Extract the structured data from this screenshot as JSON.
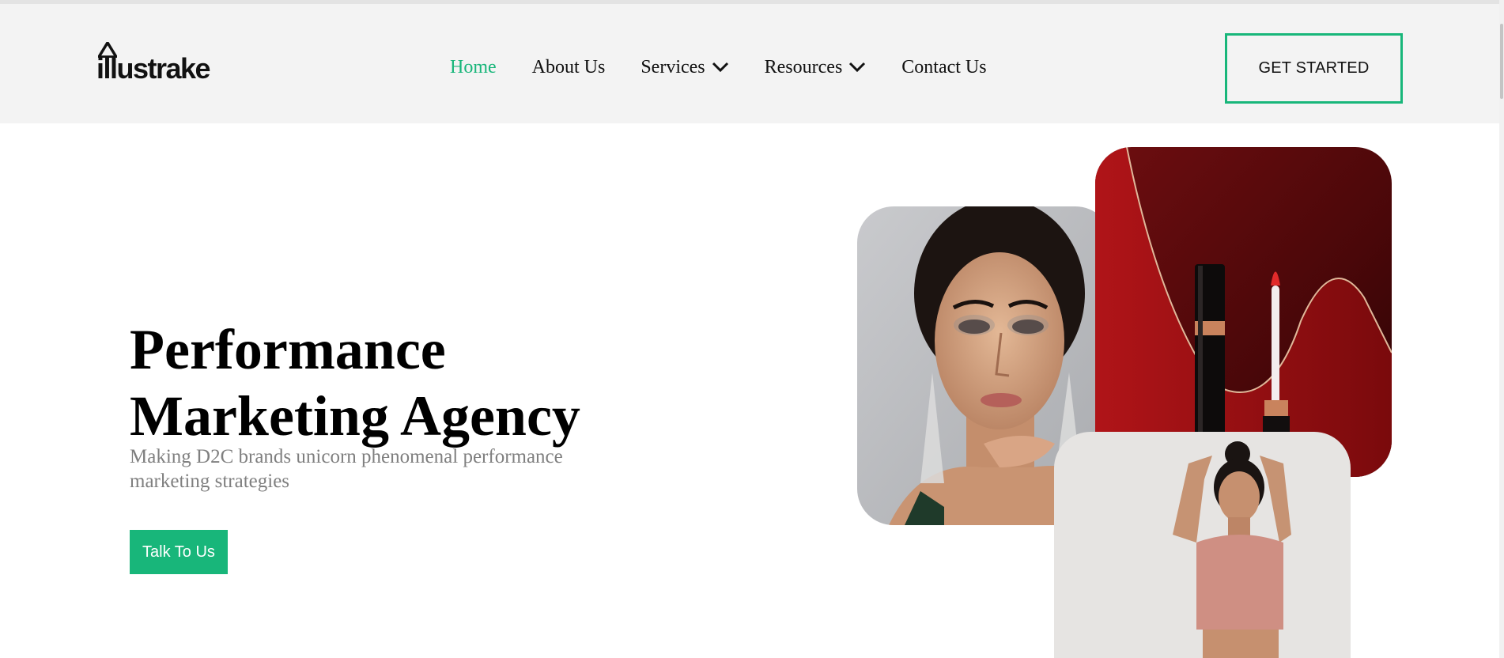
{
  "brand": {
    "name": "illustrake",
    "accent_color": "#18b67a"
  },
  "nav": {
    "items": [
      {
        "label": "Home",
        "active": true,
        "has_dropdown": false
      },
      {
        "label": "About Us",
        "active": false,
        "has_dropdown": false
      },
      {
        "label": "Services",
        "active": false,
        "has_dropdown": true
      },
      {
        "label": "Resources",
        "active": false,
        "has_dropdown": true
      },
      {
        "label": "Contact Us",
        "active": false,
        "has_dropdown": false
      }
    ],
    "cta_label": "GET STARTED"
  },
  "hero": {
    "title_line1": "Performance",
    "title_line2": "Marketing Agency",
    "subtitle": "Making D2C brands unicorn phenomenal performance marketing strategies",
    "button_label": "Talk To Us"
  },
  "images": [
    {
      "name": "woman-portrait-photo"
    },
    {
      "name": "lipstick-product-photo"
    },
    {
      "name": "model-photo"
    }
  ],
  "icons": [
    "logo-triangle-icon",
    "chevron-down-icon"
  ]
}
